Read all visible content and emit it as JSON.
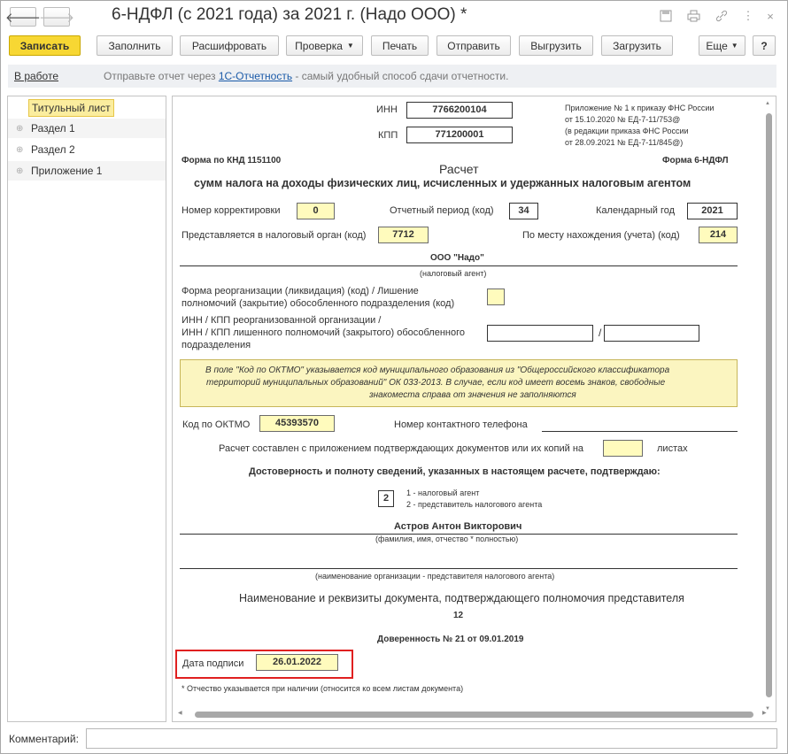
{
  "window": {
    "title": "6-НДФЛ (с 2021 года) за 2021 г. (Надо ООО) *"
  },
  "toolbar": {
    "save": "Записать",
    "fill": "Заполнить",
    "decode": "Расшифровать",
    "check": "Проверка",
    "print": "Печать",
    "send": "Отправить",
    "unload": "Выгрузить",
    "load": "Загрузить",
    "more": "Еще",
    "help": "?"
  },
  "info": {
    "status_link": "В работе",
    "message_prefix": "Отправьте отчет через ",
    "message_link": "1С-Отчетность",
    "message_suffix": " - самый удобный способ сдачи отчетности."
  },
  "sidebar": {
    "items": [
      {
        "label": "Титульный лист"
      },
      {
        "label": "Раздел 1"
      },
      {
        "label": "Раздел 2"
      },
      {
        "label": "Приложение 1"
      }
    ]
  },
  "form": {
    "inn_label": "ИНН",
    "inn": "7766200104",
    "kpp_label": "КПП",
    "kpp": "771200001",
    "appendix_line1": "Приложение № 1 к приказу ФНС России",
    "appendix_line2": "от 15.10.2020 № ЕД-7-11/753@",
    "appendix_line3": "(в редакции приказа ФНС России",
    "appendix_line4": "от 28.09.2021 № ЕД-7-11/845@)",
    "knd": "Форма по КНД 1151100",
    "form_name": "Форма 6-НДФЛ",
    "title1": "Расчет",
    "title2": "сумм налога на доходы физических лиц, исчисленных и удержанных налоговым агентом",
    "correction_label": "Номер корректировки",
    "correction": "0",
    "period_label": "Отчетный период (код)",
    "period": "34",
    "year_label": "Календарный год",
    "year": "2021",
    "tax_office_label": "Представляется в налоговый орган (код)",
    "tax_office": "7712",
    "location_label": "По месту нахождения (учета) (код)",
    "location": "214",
    "agent_name": "ООО \"Надо\"",
    "agent_caption": "(налоговый агент)",
    "reorg_label1": "Форма реорганизации (ликвидация) (код) / Лишение",
    "reorg_label2": "полномочий (закрытие) обособленного подразделения (код)",
    "reorg_inn_label1": "ИНН / КПП реорганизованной организации /",
    "reorg_inn_label2": "ИНН / КПП лишенного полномочий (закрытого) обособленного",
    "reorg_inn_label3": "подразделения",
    "reorg_sep": "/",
    "note_line1": "В поле \"Код по ОКТМО\" указывается код муниципального образования из \"Общероссийского классификатора",
    "note_line2": "территорий муниципальных образований\" ОК 033-2013. В случае, если код имеет восемь знаков, свободные",
    "note_line3": "знакоместа справа от значения не заполняются",
    "oktmo_label": "Код по ОКТМО",
    "oktmo": "45393570",
    "phone_label": "Номер контактного телефона",
    "pages_label": "Расчет составлен с приложением подтверждающих документов или их копий на",
    "pages_suffix": "листах",
    "confirm_heading": "Достоверность и полноту сведений, указанных в настоящем расчете, подтверждаю:",
    "signer_code": "2",
    "signer_opt1": "1 - налоговый агент",
    "signer_opt2": "2 - представитель налогового агента",
    "signer_name": "Астров Антон Викторович",
    "signer_caption": "(фамилия, имя, отчество * полностью)",
    "org_caption": "(наименование организации - представителя налогового агента)",
    "doc_heading": "Наименование и реквизиты документа, подтверждающего полномочия представителя",
    "doc_code": "12",
    "proxy": "Доверенность № 21 от 09.01.2019",
    "sign_date_label": "Дата подписи",
    "sign_date": "26.01.2022",
    "footnote": "* Отчество указывается при наличии (относится ко всем листам документа)"
  },
  "comment": {
    "label": "Комментарий:",
    "value": ""
  }
}
